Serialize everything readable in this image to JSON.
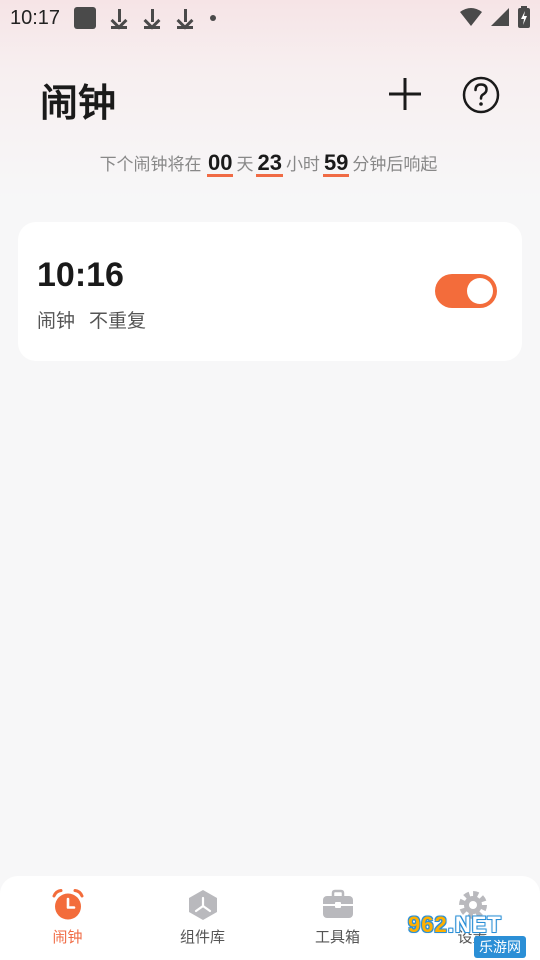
{
  "status_bar": {
    "time": "10:17"
  },
  "header": {
    "title": "闹钟",
    "add_icon": "plus-icon",
    "help_icon": "question-circle-icon"
  },
  "countdown": {
    "prefix": "下个闹钟将在",
    "days": "00",
    "days_unit": "天",
    "hours": "23",
    "hours_unit": "小时",
    "minutes": "59",
    "suffix": "分钟后响起"
  },
  "alarms": [
    {
      "time": "10:16",
      "label": "闹钟",
      "repeat": "不重复",
      "enabled": true
    }
  ],
  "bottom_nav": [
    {
      "label": "闹钟",
      "icon": "alarm-clock-icon",
      "active": true
    },
    {
      "label": "组件库",
      "icon": "widget-cube-icon",
      "active": false
    },
    {
      "label": "工具箱",
      "icon": "toolbox-icon",
      "active": false
    },
    {
      "label": "设置",
      "icon": "gear-icon",
      "active": false
    }
  ],
  "watermark": {
    "text_main": "962",
    "text_net": ".NET",
    "badge": "乐游网"
  },
  "colors": {
    "accent": "#f36c3b",
    "background": "#f7f7f8",
    "card": "#ffffff"
  }
}
